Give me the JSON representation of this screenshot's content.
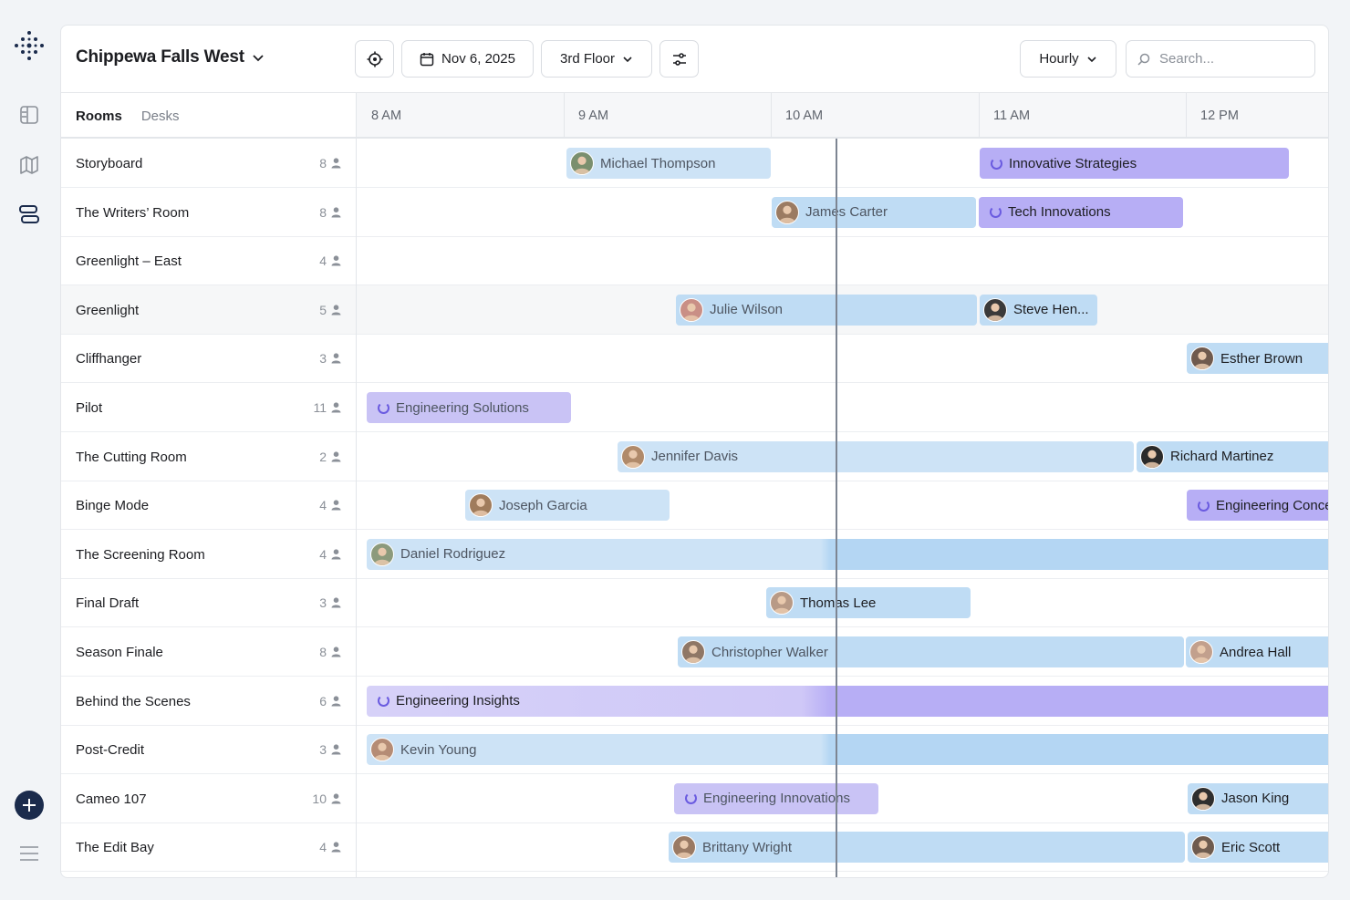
{
  "sidebar": {
    "logo_icon": "dot-grid-logo",
    "nav": [
      {
        "icon": "layout-icon"
      },
      {
        "icon": "map-icon"
      },
      {
        "icon": "schedule-icon"
      }
    ],
    "add_icon": "plus-icon",
    "menu_icon": "hamburger-menu-icon"
  },
  "toolbar": {
    "location": "Chippewa Falls West",
    "date": "Nov 6, 2025",
    "floor": "3rd Floor",
    "view": "Hourly",
    "search_placeholder": "Search..."
  },
  "tabs": [
    {
      "label": "Rooms",
      "active": true
    },
    {
      "label": "Desks",
      "active": false
    }
  ],
  "hours": [
    "8 AM",
    "9 AM",
    "10 AM",
    "11 AM",
    "12 PM"
  ],
  "current_time_label": "10:18 AM",
  "rooms": [
    {
      "name": "Storyboard",
      "capacity": "8"
    },
    {
      "name": "The Writers’ Room",
      "capacity": "8"
    },
    {
      "name": "Greenlight – East",
      "capacity": "4"
    },
    {
      "name": "Greenlight",
      "capacity": "5"
    },
    {
      "name": "Cliffhanger",
      "capacity": "3"
    },
    {
      "name": "Pilot",
      "capacity": "11"
    },
    {
      "name": "The Cutting Room",
      "capacity": "2"
    },
    {
      "name": "Binge Mode",
      "capacity": "4"
    },
    {
      "name": "The Screening Room",
      "capacity": "4"
    },
    {
      "name": "Final Draft",
      "capacity": "3"
    },
    {
      "name": "Season Finale",
      "capacity": "8"
    },
    {
      "name": "Behind the Scenes",
      "capacity": "6"
    },
    {
      "name": "Post-Credit",
      "capacity": "3"
    },
    {
      "name": "Cameo 107",
      "capacity": "10"
    },
    {
      "name": "The Edit Bay",
      "capacity": "4"
    }
  ],
  "bookings": [
    {
      "label": "Michael Thompson",
      "type": "person"
    },
    {
      "label": "Innovative Strategies",
      "type": "team"
    },
    {
      "label": "James Carter",
      "type": "person"
    },
    {
      "label": "Tech Innovations",
      "type": "team"
    },
    {
      "label": "Julie Wilson",
      "type": "person"
    },
    {
      "label": "Steve Hen...",
      "type": "person"
    },
    {
      "label": "Esther Brown",
      "type": "person"
    },
    {
      "label": "Engineering Solutions",
      "type": "team"
    },
    {
      "label": "Jennifer Davis",
      "type": "person"
    },
    {
      "label": "Richard Martinez",
      "type": "person"
    },
    {
      "label": "Joseph Garcia",
      "type": "person"
    },
    {
      "label": "Engineering Conce",
      "type": "team"
    },
    {
      "label": "Daniel Rodriguez",
      "type": "person"
    },
    {
      "label": "Thomas Lee",
      "type": "person"
    },
    {
      "label": "Christopher Walker",
      "type": "person"
    },
    {
      "label": "Andrea Hall",
      "type": "person"
    },
    {
      "label": "Engineering Insights",
      "type": "team"
    },
    {
      "label": "Kevin Young",
      "type": "person"
    },
    {
      "label": "Engineering Innovations",
      "type": "team"
    },
    {
      "label": "Jason King",
      "type": "person"
    },
    {
      "label": "Brittany Wright",
      "type": "person"
    },
    {
      "label": "Eric Scott",
      "type": "person"
    }
  ],
  "colors": {
    "person_booking": "#bfdcf4",
    "team_booking": "#c9c3f5",
    "accent": "#6a5be0",
    "now_line": "#7d8592"
  }
}
